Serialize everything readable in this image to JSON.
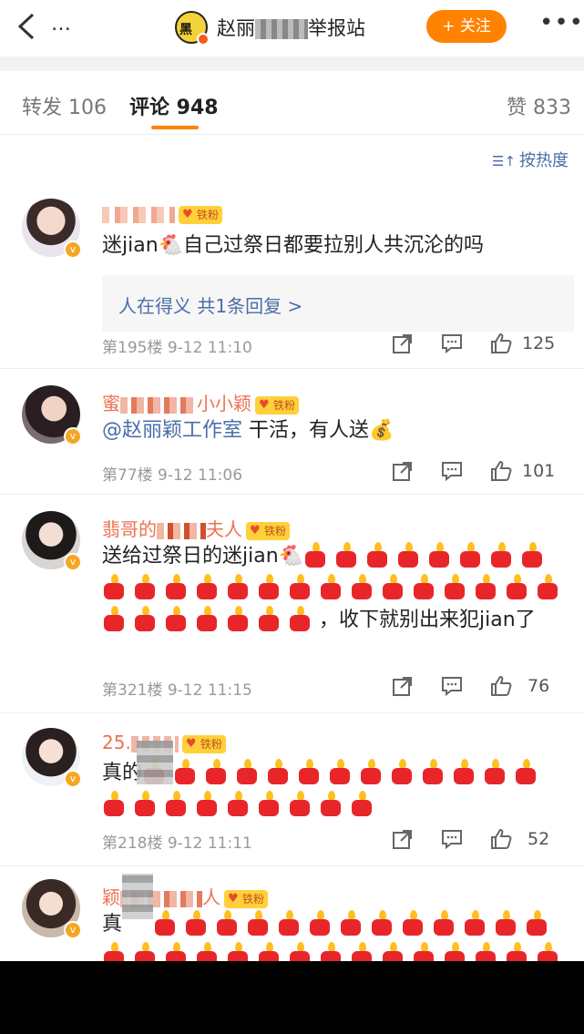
{
  "header": {
    "account_name_prefix": "赵丽",
    "account_name_suffix": "举报站",
    "account_avatar_text": "黑",
    "follow_label": "+ 关注"
  },
  "tabs": {
    "repost": "转发 106",
    "comment": "评论 948",
    "like": "赞 833"
  },
  "sort_label": "按热度",
  "comments": [
    {
      "username": "",
      "fan_badge": "铁粉",
      "text": "迷jian🐔自己过祭日都要拉别人共沉沦的吗",
      "reply_text": "人在得义 共1条回复 >",
      "meta": "第195楼 9-12 11:10",
      "likes": "125"
    },
    {
      "username_prefix": "蜜",
      "username_suffix": "小小颖",
      "fan_badge": "铁粉",
      "mention": "@赵丽颖工作室",
      "text": " 干活，有人送💰",
      "meta": "第77楼 9-12 11:06",
      "likes": "101"
    },
    {
      "username_prefix": "翡哥的",
      "username_suffix": "夫人",
      "fan_badge": "铁粉",
      "text_before": "送给过祭日的迷jian🐔",
      "text_after": "，收下就别出来犯jian了",
      "meta": "第321楼 9-12 11:15",
      "likes": "76"
    },
    {
      "username_prefix": "25.",
      "fan_badge": "铁粉",
      "text_before": "真的",
      "meta": "第218楼 9-12 11:11",
      "likes": "52"
    },
    {
      "username_prefix": "颖",
      "username_suffix": "人",
      "fan_badge": "铁粉",
      "text_before": "真"
    }
  ],
  "colors": {
    "accent": "#ff8200",
    "username": "#eb7350",
    "link": "#4a6ea8"
  }
}
